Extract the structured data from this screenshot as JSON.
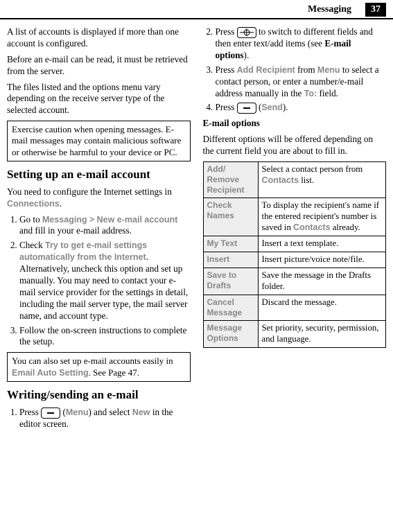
{
  "header": {
    "title": "Messaging",
    "page": "37"
  },
  "left": {
    "p1": "A list of accounts is displayed if more than one account is configured.",
    "p2": "Before an e-mail can be read, it must be retrieved from the server.",
    "p3": "The files listed and the options menu vary depending on the receive server type of the selected account.",
    "box1": "Exercise caution when opening messages. E-mail messages may contain malicious software or otherwise be harmful to your device or PC.",
    "h1": "Setting up an e-mail account",
    "p4a": "You need to configure the Internet settings in ",
    "p4b": "Connections",
    "p4c": ".",
    "s1a": "Go to ",
    "s1b": "Messaging",
    "s1c": " > ",
    "s1d": "New e-mail account",
    "s1e": " and fill in your e-mail address.",
    "s2a": "Check ",
    "s2b": "Try to get e-mail settings automatically from the Internet",
    "s2c": ". Alternatively, uncheck this option and set up manually. You may need to contact your e-mail service provider for the settings in detail, including the mail server type, the mail server name, and account type.",
    "s3": "Follow the on-screen instructions to complete the setup.",
    "box2a": "You can also set up e-mail accounts easily in ",
    "box2b": "Email Auto Setting",
    "box2c": ". See Page 47.",
    "h2": "Writing/sending an e-mail",
    "w1a": "Press ",
    "w1b": "Menu",
    "w1c": ") and select ",
    "w1d": "New",
    "w1e": " in the editor screen."
  },
  "right": {
    "r2a": "Press ",
    "r2b": " to switch to different fields and then enter text/add items (see ",
    "r2c": "E-mail options",
    "r2d": ").",
    "r3a": "Press ",
    "r3b": "Add Recipient",
    "r3c": " from ",
    "r3d": "Menu",
    "r3e": " to select a contact person, or enter a number/e-mail address manually in the ",
    "r3f": "To:",
    "r3g": " field.",
    "r4a": "Press ",
    "r4b": "Send",
    "r4c": ").",
    "h3": "E-mail options",
    "p5": "Different options will be offered depending on the current field you are about to fill in.",
    "table": [
      {
        "k": "Add/\nRemove Recipient",
        "v": [
          "Select a contact person from ",
          "Contacts",
          " list."
        ]
      },
      {
        "k": "Check Names",
        "v": [
          "To display the recipient's name if the entered recipient's number is saved in ",
          "Contacts",
          " already."
        ]
      },
      {
        "k": "My Text",
        "v": [
          "Insert a text template."
        ]
      },
      {
        "k": "Insert",
        "v": [
          "Insert picture/voice note/file."
        ]
      },
      {
        "k": "Save to Drafts",
        "v": [
          "Save the message in the Drafts folder."
        ]
      },
      {
        "k": "Cancel Message",
        "v": [
          "Discard the message."
        ]
      },
      {
        "k": "Message Options",
        "v": [
          "Set priority, security, permission, and language."
        ]
      }
    ]
  }
}
